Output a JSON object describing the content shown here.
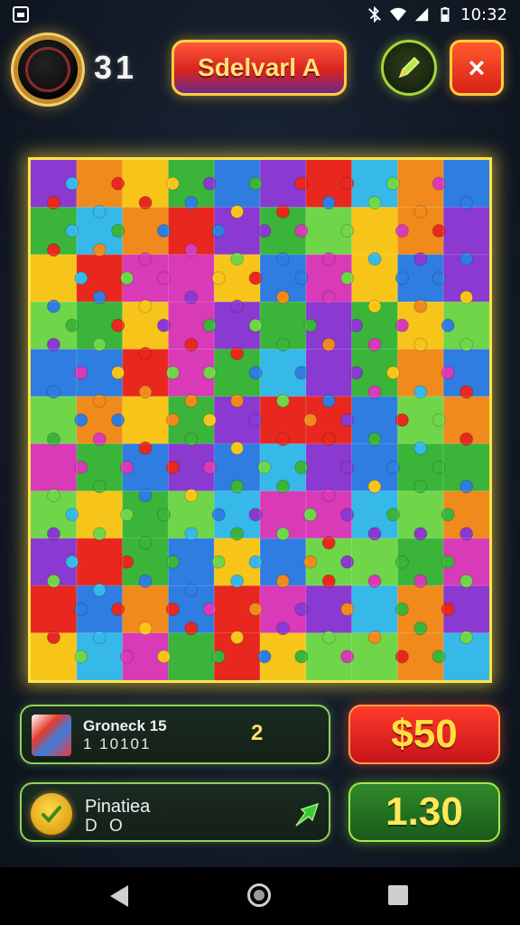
{
  "status_bar": {
    "time": "10:32",
    "icons": [
      "app-notification-icon",
      "bluetooth-off-icon",
      "wifi-icon",
      "signal-icon",
      "battery-icon"
    ]
  },
  "header": {
    "score": "31",
    "level_title": "Sdelvarl A",
    "confirm_icon": "pencil-check-icon",
    "close_label": "×"
  },
  "puzzle": {
    "rows": 11,
    "cols": 10,
    "palette": [
      "#e8281e",
      "#f7c51a",
      "#3ab53a",
      "#2f7de0",
      "#8a3ad0",
      "#f08a1c",
      "#6fd64a",
      "#36b8e8",
      "#d83ab8",
      "#ffffff"
    ]
  },
  "panels": {
    "progress": {
      "label": "Groneck 15",
      "sub": "1 10101",
      "count": "2"
    },
    "practice": {
      "label": "Pinatiea",
      "sub": "D O",
      "icon": "arrow-icon"
    }
  },
  "buttons": {
    "money": "$50",
    "time": "1.30"
  },
  "nav": {
    "back": "back-icon",
    "home": "home-icon",
    "recent": "recent-apps-icon"
  },
  "colors": {
    "accent_yellow": "#ffe34a",
    "accent_green": "#8fd35a",
    "button_red": "#d8201a",
    "button_green": "#2f8a2a"
  }
}
